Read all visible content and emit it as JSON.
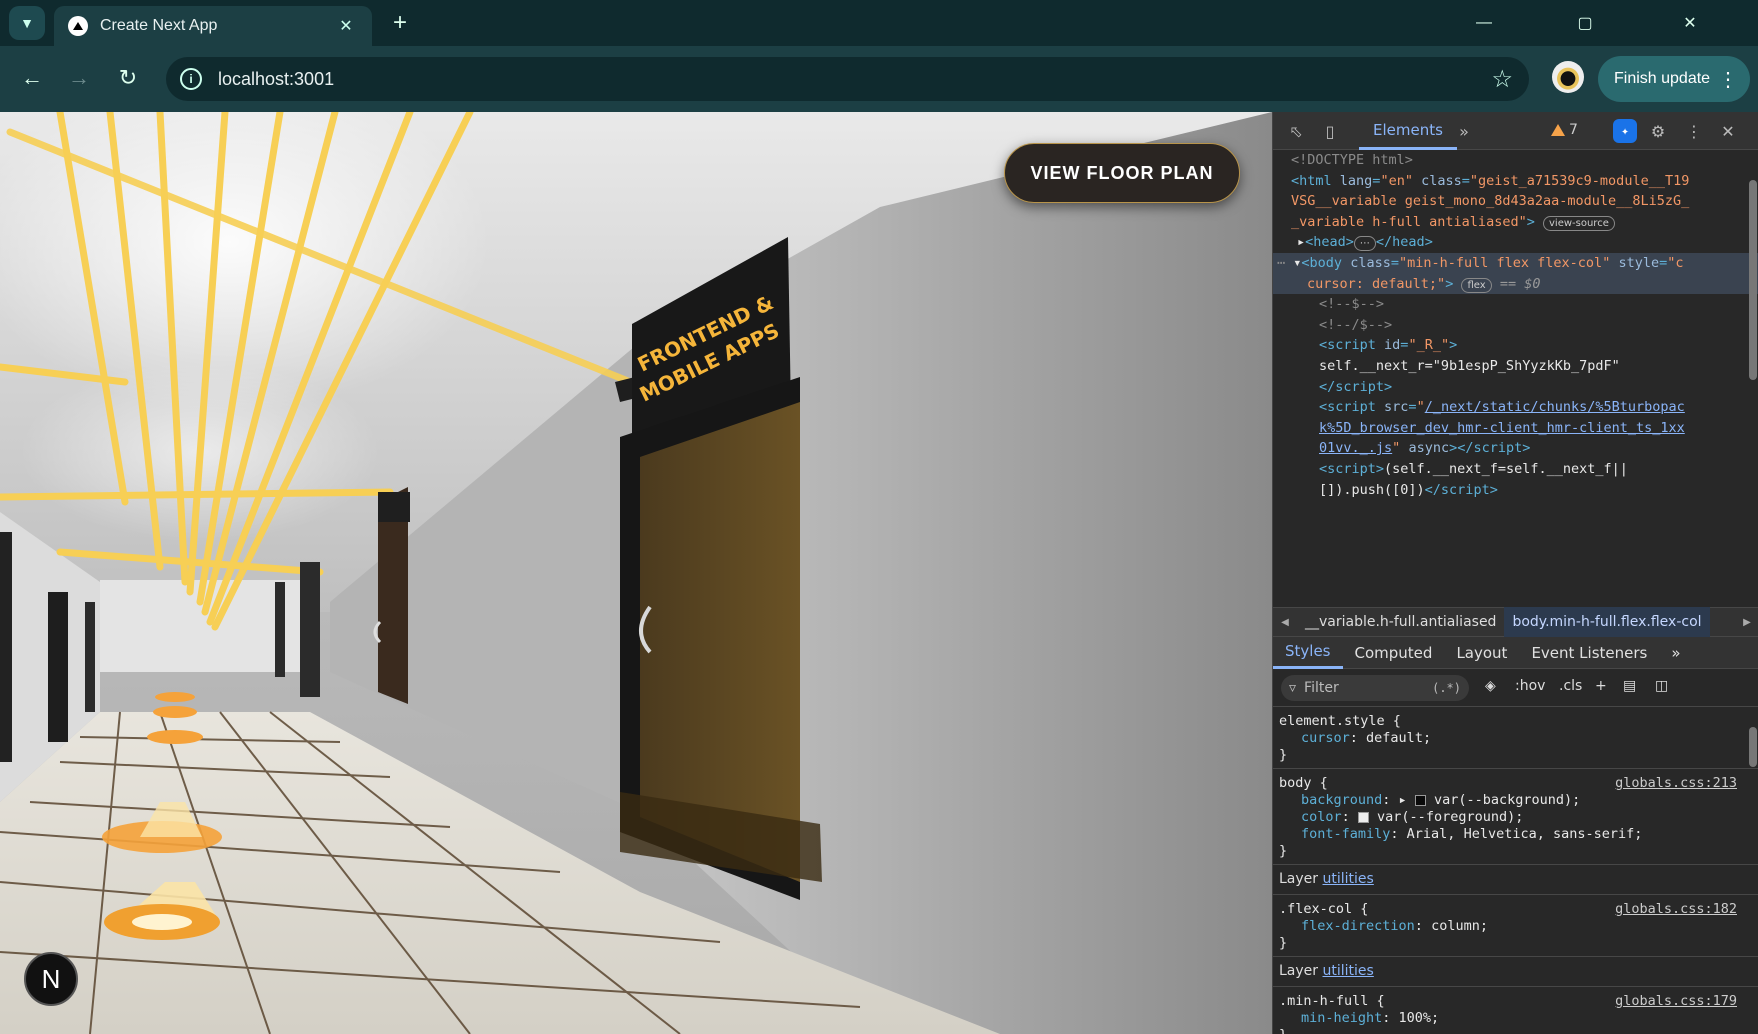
{
  "browser": {
    "tab_title": "Create Next App",
    "url": "localhost:3001",
    "finish_update_label": "Finish update"
  },
  "page": {
    "floor_plan_button": "VIEW FLOOR PLAN",
    "door_sign": "FRONTEND & MOBILE APPS",
    "next_badge": "N"
  },
  "devtools": {
    "tab_elements": "Elements",
    "warning_count": "7",
    "dom": {
      "doctype": "<!DOCTYPE html>",
      "html_class_1": "geist_a71539c9-module__T19",
      "html_class_2": "VSG__variable geist_mono_8d43a2aa-module__8Li5zG_",
      "html_class_3": "_variable h-full antialiased",
      "view_source": "view-source",
      "body_class": "min-h-full flex flex-col",
      "body_style": "cursor: default;",
      "flex_badge": "flex",
      "dollar0": "== $0",
      "comment1": "<!--$-->",
      "comment2": "<!--/$-->",
      "script_id": "_R_",
      "next_r": "self.__next_r=\"9b1espP_ShYyzkKb_7pdF\"",
      "script_src_1": "/_next/static/chunks/%5Bturbopac",
      "script_src_2": "k%5D_browser_dev_hmr-client_hmr-client_ts_1xx",
      "script_src_3": "01vv._.js",
      "push_1": "(self.__next_f=self.__next_f||",
      "push_2": "[]).push([0])"
    },
    "breadcrumbs": [
      "__variable.h-full.antialiased",
      "body.min-h-full.flex.flex-col"
    ],
    "sub_tabs": [
      "Styles",
      "Computed",
      "Layout",
      "Event Listeners"
    ],
    "filter_placeholder": "Filter",
    "filter_tools": [
      ":hov",
      ".cls"
    ],
    "styles": {
      "element_style": "element.style {",
      "cursor_value": "default;",
      "body_selector": "body {",
      "body_src": "globals.css:213",
      "background_value": "var(--background);",
      "color_value": "var(--foreground);",
      "font_family_value": "Arial, Helvetica, sans-serif;",
      "layer_label": "Layer",
      "layer_link": "utilities",
      "flexcol_selector": ".flex-col {",
      "flexcol_src": "globals.css:182",
      "flex_direction_value": "column;",
      "minh_selector": ".min-h-full {",
      "minh_src": "globals.css:179",
      "min_height_value": "100%;"
    }
  },
  "colors": {
    "accent_blue": "#8ab4f8",
    "tag_color": "#5db0d7",
    "attr_value_color": "#f29766",
    "button_gold_border": "#b8944a"
  }
}
